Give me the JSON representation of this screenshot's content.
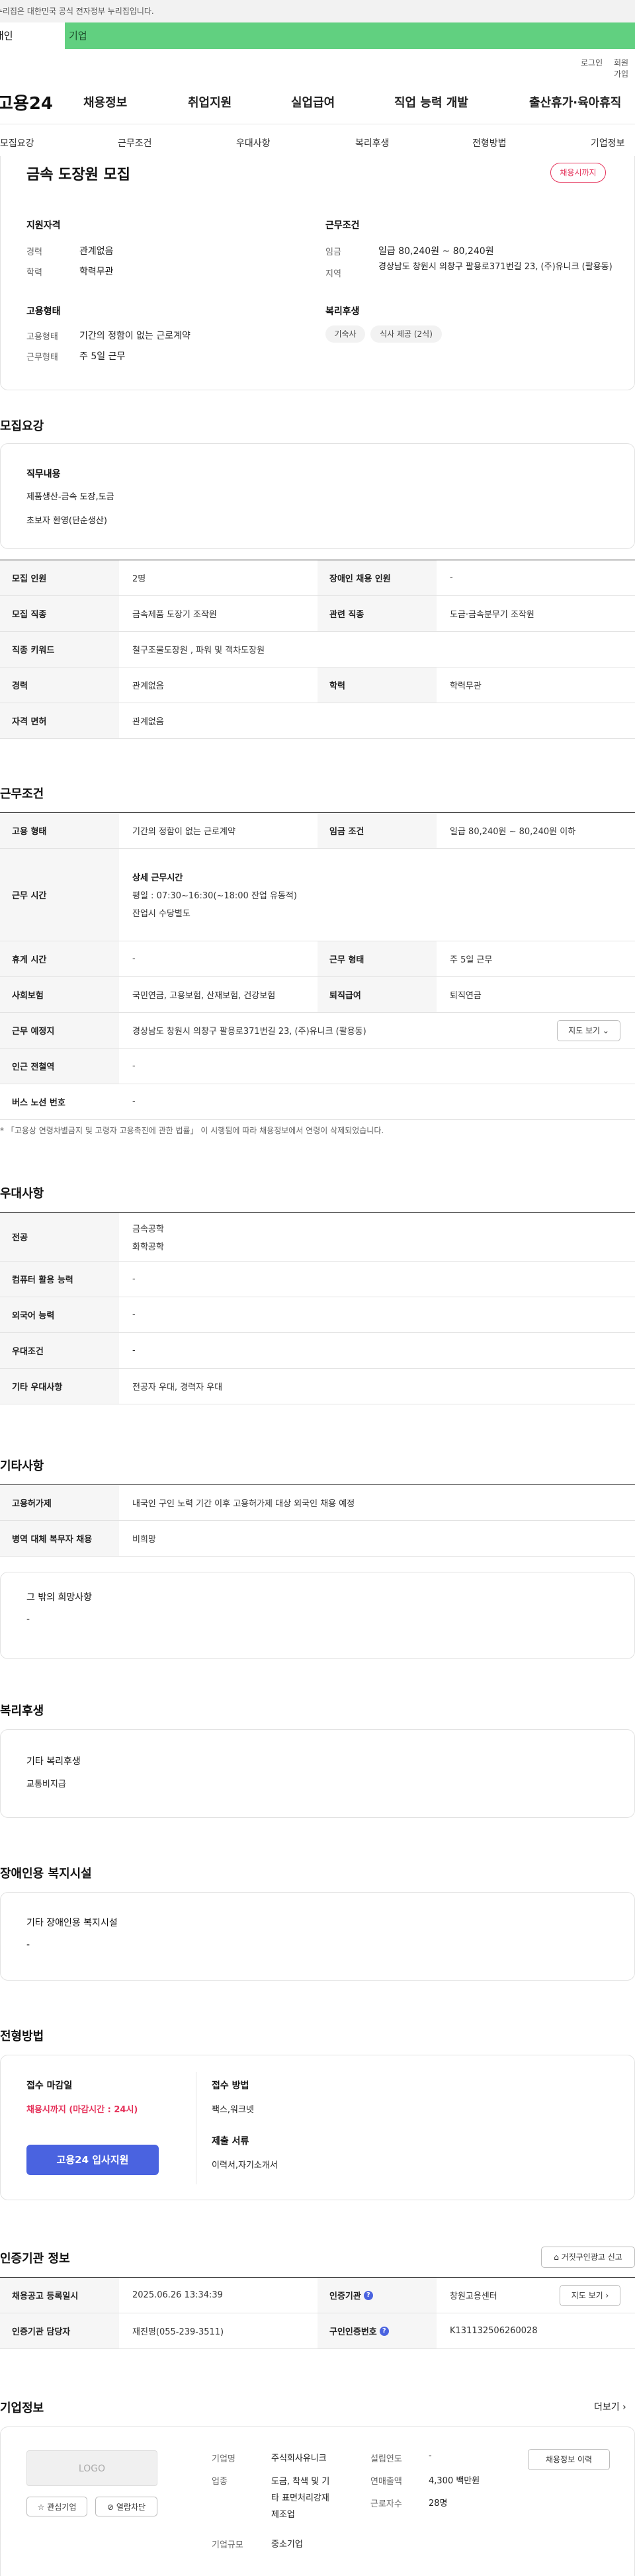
{
  "top": {
    "gov_notice": "이 누리집은 대한민국 공식 전자정부 누리집입니다.",
    "tab_personal": "개인",
    "tab_company": "기업",
    "login": "로그인",
    "signup": "회원가입"
  },
  "gnb": {
    "logo": "고용24",
    "items": [
      "채용정보",
      "취업지원",
      "실업급여",
      "직업 능력 개발",
      "출산휴가·육아휴직"
    ]
  },
  "subnav": [
    "모집요강",
    "근무조건",
    "우대사항",
    "복리후생",
    "전형방법",
    "기업정보"
  ],
  "summary": {
    "title": "금속 도장원 모집",
    "badge": "채용시까지",
    "qual_head": "지원자격",
    "career_lbl": "경력",
    "career_val": "관계없음",
    "edu_lbl": "학력",
    "edu_val": "학력무관",
    "cond_head": "근무조건",
    "wage_lbl": "임금",
    "wage_val": "일급 80,240원 ~ 80,240원",
    "region_lbl": "지역",
    "region_val": "경상남도 창원시 의창구 팔용로371번길 23, (주)유니크 (팔용동)",
    "emp_head": "고용형태",
    "emptype_lbl": "고용형태",
    "emptype_val": "기간의 정함이 없는 근로계약",
    "worktype_lbl": "근무형태",
    "worktype_val": "주 5일 근무",
    "welfare_head": "복리후생",
    "chips": [
      "기숙사",
      "식사 제공 (2식)"
    ]
  },
  "recruit": {
    "section": "모집요강",
    "duty_head": "직무내용",
    "duty_lines": [
      "제품생산-금속 도장,도금",
      "초보자 환영(단순생산)"
    ],
    "rows": [
      {
        "k1": "모집 인원",
        "v1": "2명",
        "k2": "장애인 채용 인원",
        "v2": "-"
      },
      {
        "k1": "모집 직종",
        "v1": "금속제품 도장기 조작원",
        "k2": "관련 직종",
        "v2": "도금·금속분무기 조작원"
      },
      {
        "k1": "직종 키워드",
        "v1": "철구조물도장원 , 파워 및 객차도장원"
      },
      {
        "k1": "경력",
        "v1": "관계없음",
        "k2": "학력",
        "v2": "학력무관"
      },
      {
        "k1": "자격 면허",
        "v1": "관계없음"
      }
    ]
  },
  "work": {
    "section": "근무조건",
    "r1": {
      "k1": "고용 형태",
      "v1": "기간의 정함이 없는 근로계약",
      "k2": "임금 조건",
      "v2": "일급 80,240원 ~ 80,240원 이하"
    },
    "r2": {
      "k1": "근무 시간",
      "v_head": "상세 근무시간",
      "v_lines": [
        "평일 : 07:30~16:30(~18:00 잔업 유동적)",
        "잔업시 수당별도"
      ]
    },
    "r3": {
      "k1": "휴게 시간",
      "v1": "-",
      "k2": "근무 형태",
      "v2": "주 5일 근무"
    },
    "r4": {
      "k1": "사회보험",
      "v1": "국민연금, 고용보험, 산재보험, 건강보험",
      "k2": "퇴직급여",
      "v2": "퇴직연금"
    },
    "r5": {
      "k1": "근무 예정지",
      "v1": "경상남도 창원시 의창구 팔용로371번길 23, (주)유니크 (팔용동)",
      "btn": "지도 보기"
    },
    "r6": {
      "k1": "인근 전철역",
      "v1": "-"
    },
    "r7": {
      "k1": "버스 노선 번호",
      "v1": "-"
    },
    "note": "* 「고용상 연령차별금지 및 고령자 고용촉진에 관한 법률」 이 시행됨에 따라 채용정보에서 연령이 삭제되었습니다."
  },
  "pref": {
    "section": "우대사항",
    "rows": [
      {
        "k": "전공",
        "v": [
          "금속공학",
          "화학공학"
        ]
      },
      {
        "k": "컴퓨터 활용 능력",
        "v": [
          "-"
        ]
      },
      {
        "k": "외국어 능력",
        "v": [
          "-"
        ]
      },
      {
        "k": "우대조건",
        "v": [
          "-"
        ]
      },
      {
        "k": "기타 우대사항",
        "v": [
          "전공자 우대, 경력자 우대"
        ]
      }
    ]
  },
  "etc": {
    "section": "기타사항",
    "rows": [
      {
        "k": "고용허가제",
        "v": "내국인 구인 노력 기간 이후 고용허가제 대상 외국인 채용 예정"
      },
      {
        "k": "병역 대체 복무자 채용",
        "v": "비희망"
      }
    ],
    "other_head": "그 밖의 희망사항",
    "other_val": "-"
  },
  "welfare": {
    "section": "복리후생",
    "head": "기타 복리후생",
    "val": "교통비지급"
  },
  "disab": {
    "section": "장애인용 복지시설",
    "head": "기타 장애인용 복지시설",
    "val": "-"
  },
  "screen": {
    "section": "전형방법",
    "deadline_head": "접수 마감일",
    "deadline_val": "채용시까지 (마감시간 : 24시)",
    "apply_btn": "고용24 입사지원",
    "method_head": "접수 방법",
    "method_val": "팩스,워크넷",
    "docs_head": "제출 서류",
    "docs_val": "이력서,자기소개서"
  },
  "cert": {
    "section": "인증기관 정보",
    "report_btn": "거짓구인광고 신고",
    "rows": [
      {
        "k1": "채용공고 등록일시",
        "v1": "2025.06.26 13:34:39",
        "k2": "인증기관",
        "v2": "창원고용센터",
        "btn": "지도 보기"
      },
      {
        "k1": "인증기관 담당자",
        "v1": "재진명(055-239-3511)",
        "k2": "구인인증번호",
        "v2": "K131132506260028"
      }
    ]
  },
  "company": {
    "section": "기업정보",
    "more": "더보기",
    "logo_text": "LOGO",
    "fav_btn": "관심기업",
    "block_btn": "열람차단",
    "name_lbl": "기업명",
    "name_val": "주식회사유니크",
    "industry_lbl": "업종",
    "industry_val_lines": [
      "도금, 착색 및 기",
      "타 표면처리강재",
      "제조업"
    ],
    "size_lbl": "기업규모",
    "size_val": "중소기업",
    "founded_lbl": "설립연도",
    "founded_val": "-",
    "sales_lbl": "연매출액",
    "sales_val": "4,300 백만원",
    "emp_lbl": "근로자수",
    "emp_val": "28명",
    "history_btn": "채용정보 이력"
  }
}
